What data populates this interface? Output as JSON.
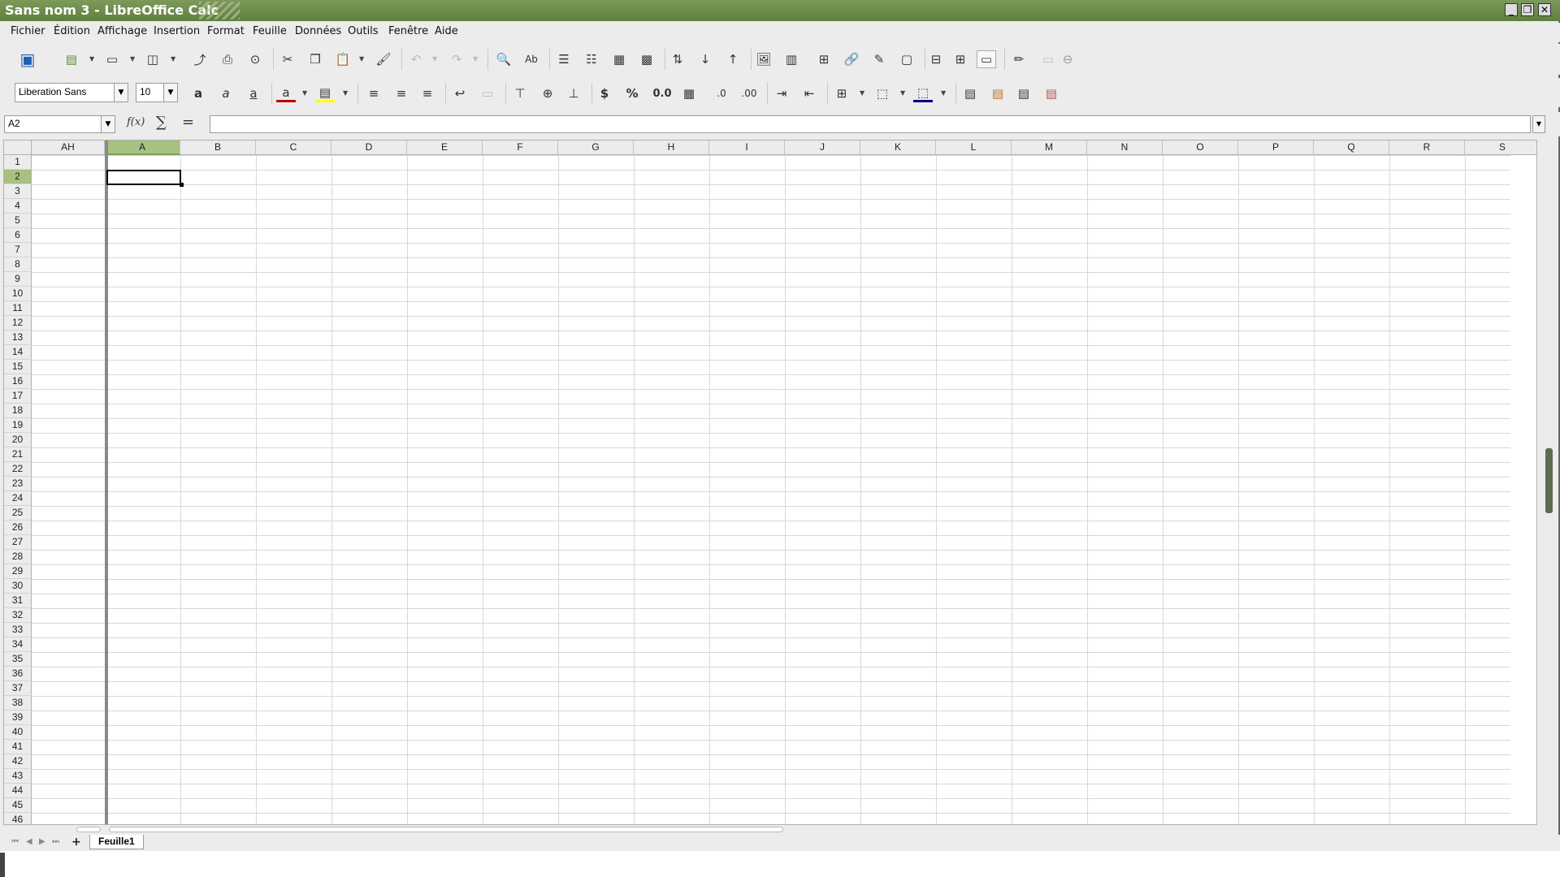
{
  "window": {
    "title": "Sans nom 3 - LibreOffice Calc"
  },
  "menu": [
    "Fichier",
    "Édition",
    "Affichage",
    "Insertion",
    "Format",
    "Feuille",
    "Données",
    "Outils",
    "Fenêtre",
    "Aide"
  ],
  "formatting": {
    "font_name": "Liberation Sans",
    "font_size": "10",
    "percent": "%",
    "decimal": "0.0",
    "currency": "$"
  },
  "namebox": {
    "value": "A2"
  },
  "formula": {
    "fx_label": "f(x)",
    "sum_label": "∑",
    "eq_label": "=",
    "value": ""
  },
  "grid": {
    "columns": [
      "AH",
      "A",
      "B",
      "C",
      "D",
      "E",
      "F",
      "G",
      "H",
      "I",
      "J",
      "K",
      "L",
      "M",
      "N",
      "O",
      "P",
      "Q",
      "R",
      "S"
    ],
    "active_column": "A",
    "row_count": 46,
    "active_row": 2
  },
  "sheets": [
    {
      "name": "Feuille1",
      "active": true
    }
  ],
  "colors": {
    "titlebar": "#6b8a48",
    "selection_header": "#a7c182"
  }
}
